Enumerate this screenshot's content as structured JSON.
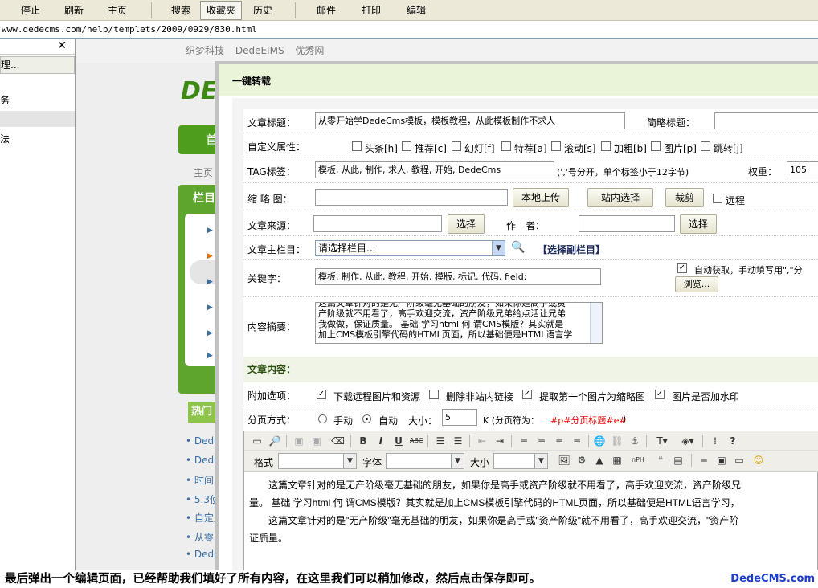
{
  "browser": {
    "toolbar": [
      "停止",
      "刷新",
      "主页",
      "搜索",
      "收藏夹",
      "历史",
      "邮件",
      "打印",
      "编辑"
    ],
    "address": "www.dedecms.com/help/templets/2009/0929/830.html"
  },
  "left_pane": {
    "close": "✕",
    "manage": "理...",
    "items": [
      "务",
      "法"
    ]
  },
  "bg_page": {
    "top_links": [
      "织梦科技",
      "DedeEIMS",
      "优秀网"
    ],
    "logo": "DE",
    "nav_first": "首",
    "crumb": "主页 >",
    "box_title": "栏目",
    "hot": "热门",
    "list": [
      "Dede",
      "Dede",
      "时间",
      "5.3使",
      "自定义",
      "从零",
      "Dede"
    ]
  },
  "panel": {
    "title": "一键转载",
    "fields": {
      "title_label": "文章标题：",
      "title_value": "从零开始学DedeCms模板，模板教程，从此模板制作不求人",
      "short_title_label": "简略标题：",
      "attr_label": "自定义属性：",
      "attrs": [
        "头条[h]",
        "推荐[c]",
        "幻灯[f]",
        "特荐[a]",
        "滚动[s]",
        "加粗[b]",
        "图片[p]",
        "跳转[j]"
      ],
      "tag_label": "TAG标签：",
      "tag_value": "模板, 从此, 制作, 求人, 教程, 开始, DedeCms",
      "tag_hint": "(','号分开，单个标签小于12字节)",
      "weight_label": "权重：",
      "weight_value": "105",
      "thumb_label": "缩 略 图：",
      "btn_upload": "本地上传",
      "btn_site": "站内选择",
      "btn_crop": "裁剪",
      "remote_label": "远程",
      "source_label": "文章来源：",
      "btn_select": "选择",
      "author_label": "作　者：",
      "btn_select2": "选择",
      "column_label": "文章主栏目：",
      "column_value": "请选择栏目...",
      "sub_column": "【选择副栏目】",
      "keyword_label": "关键字：",
      "keyword_value": "模板, 制作, 从此, 教程, 开始, 模版, 标记, 代码, field:",
      "auto_get": "自动获取，手动填写用\",\"分",
      "btn_browse": "浏览...",
      "summary_label": "内容摘要：",
      "summary_lines": [
        "这篇文章针对的是无产阶级毫无基础的朋友，如果你是高手或资",
        "产阶级就不用看了，高手欢迎交流，资产阶级兄弟给点活让兄弟",
        "我做做，保证质量。 基础 学习html 何 谓CMS模版？其实就是",
        "加上CMS模板引擎代码的HTML页面，所以基础便是HTML语言学"
      ],
      "content_section": "文章内容：",
      "extra_label": "附加选项：",
      "extra_opts": [
        "下载远程图片和资源",
        "删除非站内链接",
        "提取第一个图片为缩略图",
        "图片是否加水印"
      ],
      "paging_label": "分页方式：",
      "paging_manual": "手动",
      "paging_auto": "自动",
      "size_label": "大小：",
      "size_value": "5",
      "size_unit": "K (分页符为：",
      "page_marker": "#p#分页标题#e#",
      "page_close": ")"
    },
    "editor": {
      "format_label": "格式",
      "font_label": "字体",
      "size_label": "大小",
      "body": [
        "这篇文章针对的是无产阶级毫无基础的朋友，如果你是高手或资产阶级就不用看了，高手欢迎交流，资产阶级兄",
        "量。 基础 学习html 何 谓CMS模版？其实就是加上CMS模板引擎代码的HTML页面，所以基础便是HTML语言学习，",
        "这篇文章针对的是\"无产阶级\"毫无基础的朋友，如果你是高手或\"资产阶级\"就不用看了，高手欢迎交流，\"资产阶",
        "证质量。"
      ]
    }
  },
  "caption": {
    "text": "最后弹出一个编辑页面，已经帮助我们填好了所有内容，在这里我们可以稍加修改，然后点击保存即可。",
    "brand": "DedeCMS.com"
  }
}
